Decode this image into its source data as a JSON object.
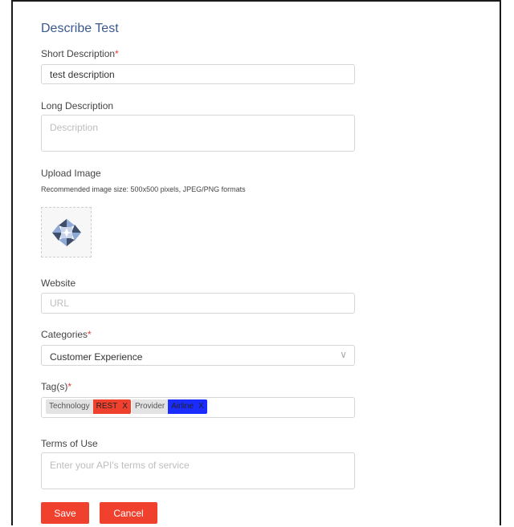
{
  "form": {
    "title": "Describe Test",
    "short_description": {
      "label": "Short Description",
      "required_mark": "*",
      "value": "test description"
    },
    "long_description": {
      "label": "Long Description",
      "placeholder": "Description"
    },
    "upload_image": {
      "label": "Upload Image",
      "hint": "Recommended image size: 500x500 pixels, JPEG/PNG formats"
    },
    "website": {
      "label": "Website",
      "placeholder": "URL"
    },
    "categories": {
      "label": "Categories",
      "required_mark": "*",
      "value": "Customer Experience"
    },
    "tags": {
      "label": "Tag(s)",
      "required_mark": "*",
      "items": [
        {
          "key": "Technology",
          "value": "REST",
          "remove": "X",
          "color": "#f0412f"
        },
        {
          "key": "Provider",
          "value": "Airline",
          "remove": "X",
          "color": "#1a2cff"
        }
      ]
    },
    "terms": {
      "label": "Terms of Use",
      "placeholder": "Enter your API's terms of service"
    },
    "buttons": {
      "save": "Save",
      "cancel": "Cancel"
    }
  },
  "colors": {
    "accent": "#f0412f",
    "title": "#3a5a8c"
  }
}
